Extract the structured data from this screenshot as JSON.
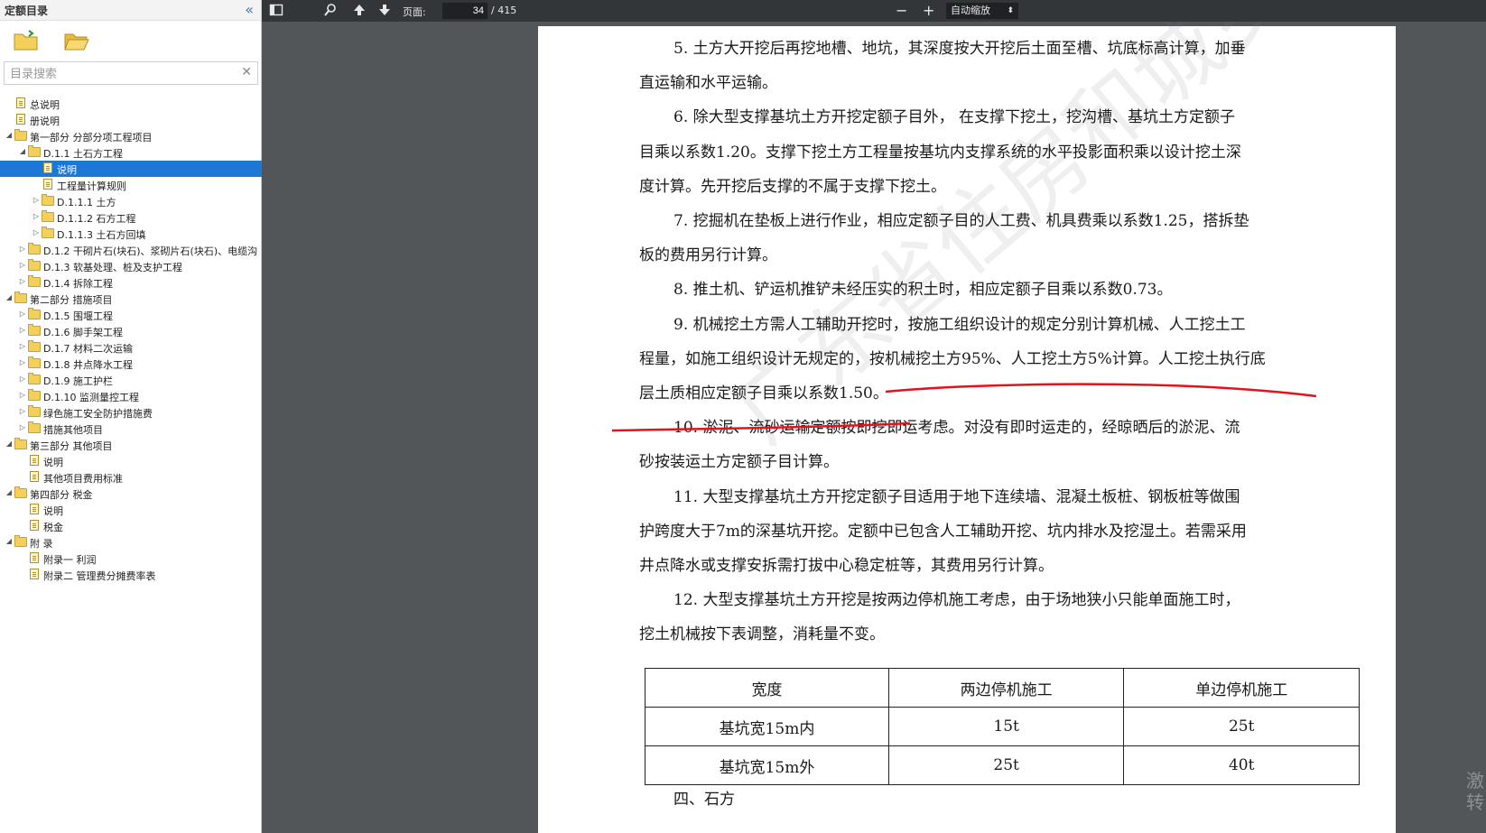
{
  "sidebar": {
    "title": "定额目录",
    "search_placeholder": "目录搜索",
    "items": [
      {
        "label": "总说明",
        "level": 0,
        "type": "doc"
      },
      {
        "label": "册说明",
        "level": 0,
        "type": "doc"
      },
      {
        "label": "第一部分 分部分项工程项目",
        "level": 0,
        "type": "folder",
        "expanded": true
      },
      {
        "label": "D.1.1 土石方工程",
        "level": 1,
        "type": "folder",
        "expanded": true
      },
      {
        "label": "说明",
        "level": 2,
        "type": "doc",
        "selected": true
      },
      {
        "label": "工程量计算规则",
        "level": 2,
        "type": "doc"
      },
      {
        "label": "D.1.1.1 土方",
        "level": 2,
        "type": "folder",
        "expanded": false
      },
      {
        "label": "D.1.1.2 石方工程",
        "level": 2,
        "type": "folder",
        "expanded": false
      },
      {
        "label": "D.1.1.3 土石方回填",
        "level": 2,
        "type": "folder",
        "expanded": false
      },
      {
        "label": "D.1.2 干砌片石(块石)、浆砌片石(块石)、电缆沟",
        "level": 1,
        "type": "folder",
        "expanded": false
      },
      {
        "label": "D.1.3 软基处理、桩及支护工程",
        "level": 1,
        "type": "folder",
        "expanded": false
      },
      {
        "label": "D.1.4 拆除工程",
        "level": 1,
        "type": "folder",
        "expanded": false
      },
      {
        "label": "第二部分 措施项目",
        "level": 0,
        "type": "folder",
        "expanded": true
      },
      {
        "label": "D.1.5 围堰工程",
        "level": 1,
        "type": "folder",
        "expanded": false
      },
      {
        "label": "D.1.6 脚手架工程",
        "level": 1,
        "type": "folder",
        "expanded": false
      },
      {
        "label": "D.1.7 材料二次运输",
        "level": 1,
        "type": "folder",
        "expanded": false
      },
      {
        "label": "D.1.8 井点降水工程",
        "level": 1,
        "type": "folder",
        "expanded": false
      },
      {
        "label": "D.1.9 施工护栏",
        "level": 1,
        "type": "folder",
        "expanded": false
      },
      {
        "label": "D.1.10 监测量控工程",
        "level": 1,
        "type": "folder",
        "expanded": false
      },
      {
        "label": "绿色施工安全防护措施费",
        "level": 1,
        "type": "folder",
        "expanded": false
      },
      {
        "label": "措施其他项目",
        "level": 1,
        "type": "folder",
        "expanded": false
      },
      {
        "label": "第三部分 其他项目",
        "level": 0,
        "type": "folder",
        "expanded": true
      },
      {
        "label": "说明",
        "level": 1,
        "type": "doc"
      },
      {
        "label": "其他项目费用标准",
        "level": 1,
        "type": "doc"
      },
      {
        "label": "第四部分 税金",
        "level": 0,
        "type": "folder",
        "expanded": true
      },
      {
        "label": "说明",
        "level": 1,
        "type": "doc"
      },
      {
        "label": "税金",
        "level": 1,
        "type": "doc"
      },
      {
        "label": "附 录",
        "level": 0,
        "type": "folder",
        "expanded": true
      },
      {
        "label": "附录一 利润",
        "level": 1,
        "type": "doc"
      },
      {
        "label": "附录二 管理费分摊费率表",
        "level": 1,
        "type": "doc"
      }
    ]
  },
  "toolbar": {
    "page_label": "页面:",
    "current_page": "34",
    "total_pages": "/ 415",
    "zoom_out": "−",
    "zoom_in": "+",
    "zoom_value": "自动缩放"
  },
  "document": {
    "lines": [
      "5.  土方大开挖后再挖地槽、地坑，其深度按大开挖后土面至槽、坑底标高计算，加垂",
      "直运输和水平运输。",
      "6.  除大型支撑基坑土方开挖定额子目外，  在支撑下挖土，挖沟槽、基坑土方定额子",
      "目乘以系数1.20。支撑下挖土方工程量按基坑内支撑系统的水平投影面积乘以设计挖土深",
      "度计算。先开挖后支撑的不属于支撑下挖土。",
      "7.  挖掘机在垫板上进行作业，相应定额子目的人工费、机具费乘以系数1.25，搭拆垫",
      "板的费用另行计算。",
      "8.  推土机、铲运机推铲未经压实的积土时，相应定额子目乘以系数0.73。",
      "9.  机械挖土方需人工辅助开挖时，按施工组织设计的规定分别计算机械、人工挖土工",
      "程量，如施工组织设计无规定的，按机械挖土方95%、人工挖土方5%计算。人工挖土执行底",
      "层土质相应定额子目乘以系数1.50。",
      "10.  淤泥、流砂运输定额按即挖即运考虑。对没有即时运走的，经晾晒后的淤泥、流",
      "砂按装运土方定额子目计算。",
      "11.  大型支撑基坑土方开挖定额子目适用于地下连续墙、混凝土板桩、钢板桩等做围",
      "护跨度大于7m的深基坑开挖。定额中已包含人工辅助开挖、坑内排水及挖湿土。若需采用",
      "井点降水或支撑安拆需打拔中心稳定桩等，其费用另行计算。",
      "12.  大型支撑基坑土方开挖是按两边停机施工考虑，由于场地狭小只能单面施工时，",
      "挖土机械按下表调整，消耗量不变。"
    ],
    "table": {
      "headers": [
        "宽度",
        "两边停机施工",
        "单边停机施工"
      ],
      "rows": [
        [
          "基坑宽15m内",
          "15t",
          "25t"
        ],
        [
          "基坑宽15m外",
          "25t",
          "40t"
        ]
      ]
    },
    "section_heading": "四、石方",
    "watermark": "广东省住房和城乡建设厅",
    "annotation_color": "#e0141e"
  },
  "corner_watermark": [
    "激",
    "转"
  ]
}
